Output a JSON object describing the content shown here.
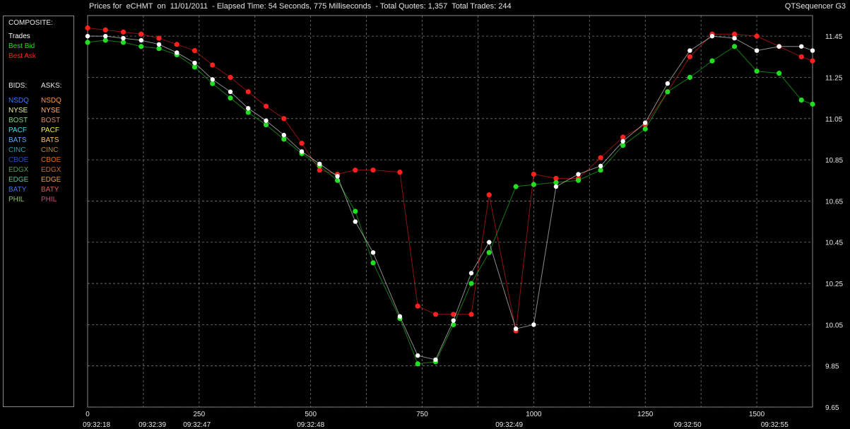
{
  "header": {
    "title": "Prices for  eCHMT  on  11/01/2011  - Elapsed Time: 54 Seconds, 775 Milliseconds  - Total Quotes: 1,357  Total Trades: 244",
    "app_name": "QTSequencer G3"
  },
  "legend": {
    "composite_label": "COMPOSITE:",
    "composite": [
      {
        "label": "Trades",
        "color": "#ffffff"
      },
      {
        "label": "Best Bid",
        "color": "#22dd22"
      },
      {
        "label": "Best Ask",
        "color": "#ff2020"
      }
    ],
    "bids_label": "BIDS:",
    "asks_label": "ASKS:",
    "exchanges": [
      {
        "bid": "NSDQ",
        "ask": "NSDQ",
        "bid_color": "#3a7bff",
        "ask_color": "#ff9a3a"
      },
      {
        "bid": "NYSE",
        "ask": "NYSE",
        "bid_color": "#e8f0a0",
        "ask_color": "#ffb070"
      },
      {
        "bid": "BOST",
        "ask": "BOST",
        "bid_color": "#7ed87e",
        "ask_color": "#d88a5a"
      },
      {
        "bid": "PACF",
        "ask": "PACF",
        "bid_color": "#40e0f0",
        "ask_color": "#f0f040"
      },
      {
        "bid": "BATS",
        "ask": "BATS",
        "bid_color": "#60a8ff",
        "ask_color": "#ffc060"
      },
      {
        "bid": "CINC",
        "ask": "CINC",
        "bid_color": "#3a9aa8",
        "ask_color": "#b08a3a"
      },
      {
        "bid": "CBOE",
        "ask": "CBOE",
        "bid_color": "#2050c0",
        "ask_color": "#e06a10"
      },
      {
        "bid": "EDGX",
        "ask": "EDGX",
        "bid_color": "#5a9a5a",
        "ask_color": "#c06a3a"
      },
      {
        "bid": "EDGE",
        "ask": "EDGE",
        "bid_color": "#60c090",
        "ask_color": "#e0a050"
      },
      {
        "bid": "BATY",
        "ask": "BATY",
        "bid_color": "#4a70e0",
        "ask_color": "#e05a5a"
      },
      {
        "bid": "PHIL",
        "ask": "PHIL",
        "bid_color": "#90c070",
        "ask_color": "#c05080"
      }
    ]
  },
  "chart_data": {
    "type": "line",
    "title": "",
    "xlabel": "",
    "ylabel": "",
    "xlim": [
      0,
      1625
    ],
    "ylim": [
      9.65,
      11.55
    ],
    "y_ticks": [
      "11.45",
      "11.25",
      "11.05",
      "10.85",
      "10.65",
      "10.45",
      "10.25",
      "10.05",
      "9.85",
      "9.65"
    ],
    "y_tick_values": [
      11.45,
      11.25,
      11.05,
      10.85,
      10.65,
      10.45,
      10.25,
      10.05,
      9.85,
      9.65
    ],
    "x_ticks": [
      "0",
      "250",
      "500",
      "750",
      "1000",
      "1250",
      "1500"
    ],
    "x_tick_values": [
      0,
      250,
      500,
      750,
      1000,
      1250,
      1500
    ],
    "time_labels": [
      {
        "x": 20,
        "label": "09:32:18"
      },
      {
        "x": 145,
        "label": "09:32:39"
      },
      {
        "x": 245,
        "label": "09:32:47"
      },
      {
        "x": 500,
        "label": "09:32:48"
      },
      {
        "x": 945,
        "label": "09:32:49"
      },
      {
        "x": 1345,
        "label": "09:32:50"
      },
      {
        "x": 1540,
        "label": "09:32:55"
      }
    ],
    "grid": true,
    "series": [
      {
        "name": "Best Ask",
        "color": "#ff2020",
        "x": [
          0,
          40,
          80,
          120,
          160,
          200,
          240,
          280,
          320,
          360,
          400,
          440,
          480,
          520,
          560,
          600,
          640,
          700,
          740,
          780,
          820,
          860,
          900,
          960,
          1000,
          1050,
          1100,
          1150,
          1200,
          1250,
          1300,
          1350,
          1400,
          1450,
          1500,
          1550,
          1600,
          1625
        ],
        "y": [
          11.49,
          11.48,
          11.47,
          11.46,
          11.44,
          11.41,
          11.38,
          11.31,
          11.25,
          11.18,
          11.11,
          11.05,
          10.93,
          10.8,
          10.78,
          10.8,
          10.8,
          10.79,
          10.14,
          10.1,
          10.1,
          10.1,
          10.68,
          10.02,
          10.78,
          10.76,
          10.76,
          10.86,
          10.96,
          11.02,
          11.18,
          11.35,
          11.46,
          11.46,
          11.45,
          11.4,
          11.35,
          11.33
        ]
      },
      {
        "name": "Best Bid",
        "color": "#22dd22",
        "x": [
          0,
          40,
          80,
          120,
          160,
          200,
          240,
          280,
          320,
          360,
          400,
          440,
          480,
          520,
          560,
          600,
          640,
          700,
          740,
          780,
          820,
          860,
          900,
          960,
          1000,
          1050,
          1100,
          1150,
          1200,
          1250,
          1300,
          1350,
          1400,
          1450,
          1500,
          1550,
          1600,
          1625
        ],
        "y": [
          11.42,
          11.43,
          11.42,
          11.4,
          11.39,
          11.36,
          11.3,
          11.22,
          11.15,
          11.08,
          11.02,
          10.95,
          10.88,
          10.82,
          10.75,
          10.6,
          10.35,
          10.08,
          9.86,
          9.87,
          10.05,
          10.25,
          10.4,
          10.72,
          10.73,
          10.74,
          10.75,
          10.8,
          10.92,
          11.0,
          11.18,
          11.25,
          11.33,
          11.4,
          11.28,
          11.27,
          11.14,
          11.12
        ]
      },
      {
        "name": "Trades",
        "color": "#ffffff",
        "x": [
          0,
          40,
          80,
          120,
          160,
          200,
          240,
          280,
          320,
          360,
          400,
          440,
          480,
          520,
          560,
          600,
          640,
          700,
          740,
          780,
          820,
          860,
          900,
          960,
          1000,
          1050,
          1100,
          1150,
          1200,
          1250,
          1300,
          1350,
          1400,
          1450,
          1500,
          1550,
          1600,
          1625
        ],
        "y": [
          11.45,
          11.45,
          11.44,
          11.43,
          11.41,
          11.37,
          11.32,
          11.24,
          11.18,
          11.1,
          11.04,
          10.97,
          10.89,
          10.83,
          10.77,
          10.55,
          10.4,
          10.09,
          9.9,
          9.88,
          10.07,
          10.3,
          10.45,
          10.03,
          10.05,
          10.72,
          10.78,
          10.82,
          10.94,
          11.03,
          11.22,
          11.38,
          11.45,
          11.44,
          11.38,
          11.4,
          11.4,
          11.38
        ]
      }
    ]
  }
}
